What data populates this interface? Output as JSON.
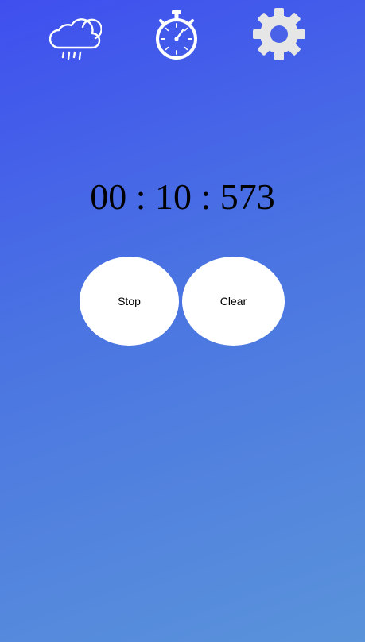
{
  "nav": {
    "items": [
      {
        "icon": "weather-rain-cloud-icon"
      },
      {
        "icon": "stopwatch-icon"
      },
      {
        "icon": "gear-icon"
      }
    ]
  },
  "timer": {
    "display": "00 : 10 : 573"
  },
  "controls": {
    "stop_label": "Stop",
    "clear_label": "Clear"
  },
  "colors": {
    "gradient_start": "#3f4fef",
    "gradient_end": "#5a93da",
    "icon": "#ffffff",
    "gear": "#e6e6e6",
    "button_bg": "#ffffff",
    "text": "#000000"
  }
}
